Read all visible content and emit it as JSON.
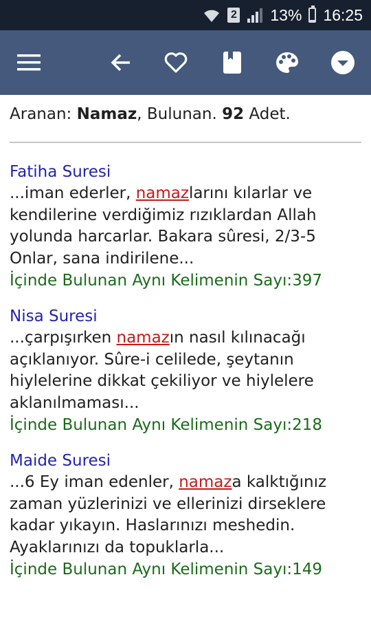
{
  "status_bar": {
    "sim_slot": "2",
    "battery": "13%",
    "time": "16:25"
  },
  "toolbar": {
    "icons": [
      "menu-icon",
      "back-arrow-icon",
      "heart-icon",
      "bookmark-icon",
      "palette-icon",
      "dropdown-icon"
    ]
  },
  "summary": {
    "prefix": "Aranan: ",
    "query": "Namaz",
    "middle": ", Bulunan. ",
    "count": "92",
    "suffix": " Adet."
  },
  "results": [
    {
      "title": "Fatiha Suresi",
      "before": "...iman ederler, ",
      "highlight": "namaz",
      "after": "larını kılarlar ve kendilerine verdiğimiz rızıklardan Allah yolunda harcarlar. Bakara sûresi, 2/3-5 Onlar, sana indirilene...",
      "count_line": "İçinde Bulunan Aynı Kelimenin Sayı:397"
    },
    {
      "title": "Nisa Suresi",
      "before": "...çarpışırken ",
      "highlight": "namaz",
      "after": "ın nasıl kılınacağı açıklanıyor. Sûre-i celilede, şeytanın hiylelerine dikkat çekiliyor ve hiylelere aklanılmaması...",
      "count_line": "İçinde Bulunan Aynı Kelimenin Sayı:218"
    },
    {
      "title": "Maide Suresi",
      "before": "...6 Ey iman edenler, ",
      "highlight": "namaz",
      "after": "a kalktığınız zaman yüzlerinizi ve ellerinizi dirseklere kadar yıkayın. Haslarınızı meshedin. Ayaklarınızı da topuklarla...",
      "count_line": "İçinde Bulunan Aynı Kelimenin Sayı:149"
    }
  ],
  "colors": {
    "status_bar": "#17202e",
    "toolbar": "#44597c",
    "title": "#2323b0",
    "highlight": "#c81818",
    "count": "#1a6b1a"
  }
}
